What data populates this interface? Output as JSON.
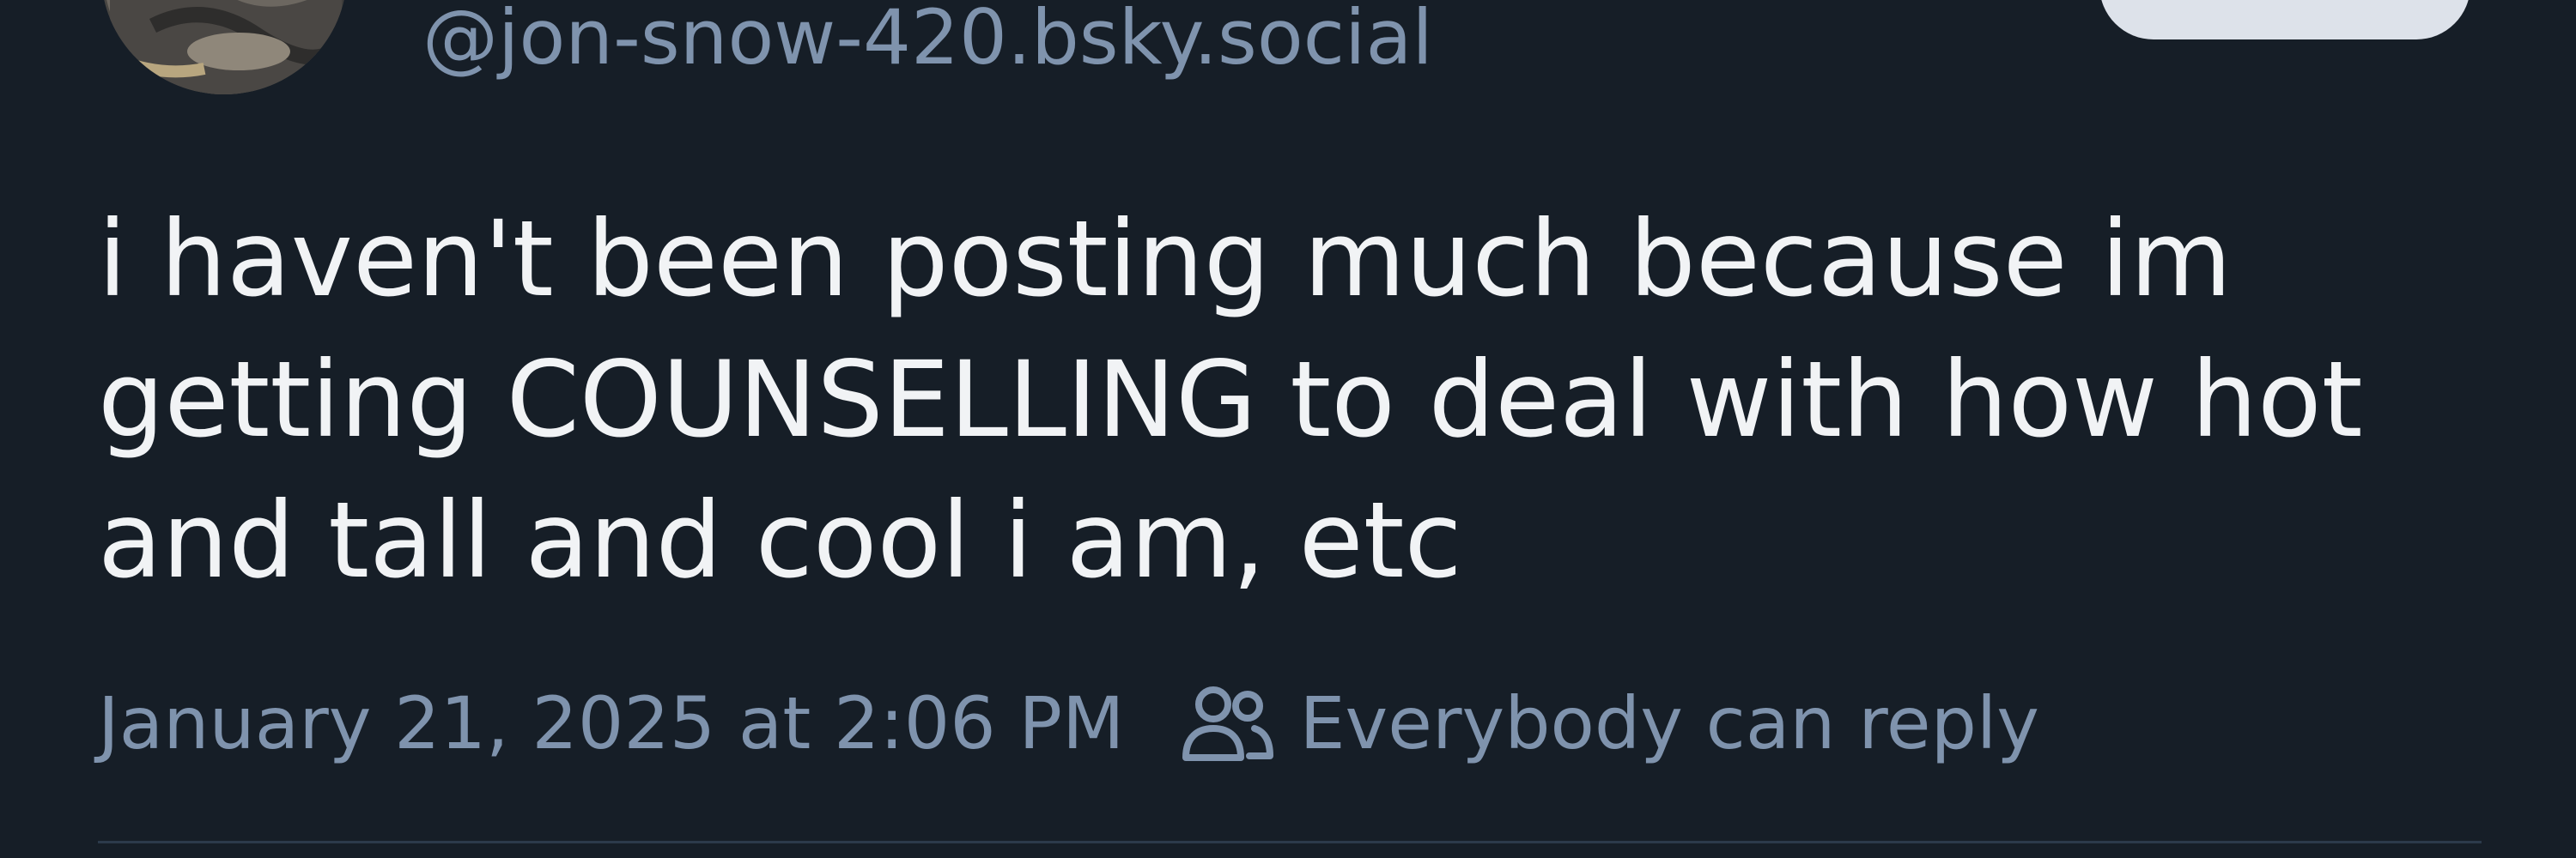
{
  "post": {
    "handle": "@jon-snow-420.bsky.social",
    "text": "i haven't been posting much because im\ngetting COUNSELLING to deal with how hot\nand tall and cool i am, etc",
    "timestamp": "January 21, 2025 at 2:06 PM",
    "reply_setting": "Everybody can reply",
    "reply_icon": "people-icon"
  },
  "colors": {
    "background": "#161e27",
    "text": "#f1f3f5",
    "muted": "#7f93ad",
    "follow_button": "#dde2ea"
  }
}
